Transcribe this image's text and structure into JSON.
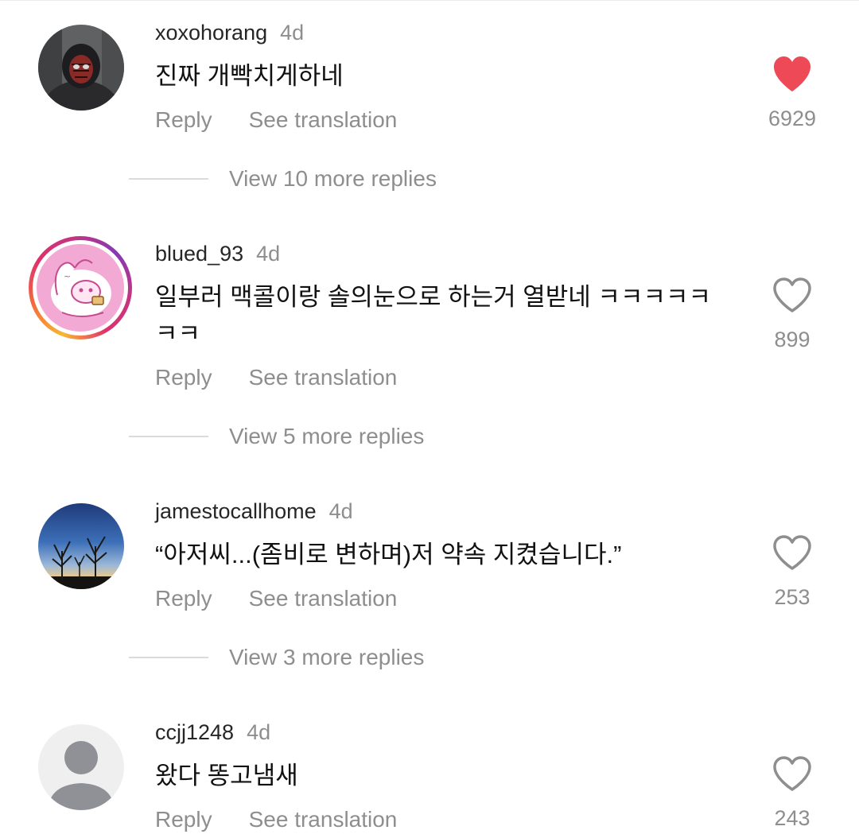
{
  "comments": [
    {
      "username": "xoxohorang",
      "time": "4d",
      "text": "진짜 개빡치게하네",
      "reply_label": "Reply",
      "translate_label": "See translation",
      "likes": "6929",
      "liked": true,
      "view_replies": "View 10 more replies"
    },
    {
      "username": "blued_93",
      "time": "4d",
      "text": "일부러 맥콜이랑 솔의눈으로 하는거 열받네 ㅋㅋㅋㅋㅋㅋㅋ",
      "reply_label": "Reply",
      "translate_label": "See translation",
      "likes": "899",
      "liked": false,
      "view_replies": "View 5 more replies"
    },
    {
      "username": "jamestocallhome",
      "time": "4d",
      "text": "“아저씨...(좀비로 변하며)저 약속 지켰습니다.”",
      "reply_label": "Reply",
      "translate_label": "See translation",
      "likes": "253",
      "liked": false,
      "view_replies": "View 3 more replies"
    },
    {
      "username": "ccjj1248",
      "time": "4d",
      "text": "왔다 똥고냄새",
      "reply_label": "Reply",
      "translate_label": "See translation",
      "likes": "243",
      "liked": false
    }
  ],
  "icons": {
    "liked_heart": "heart-filled-icon",
    "heart": "heart-outline-icon",
    "default_avatar": "default-avatar-icon"
  },
  "colors": {
    "liked": "#ed4956",
    "secondary_text": "#8e8e8e",
    "primary_text": "#262626"
  }
}
